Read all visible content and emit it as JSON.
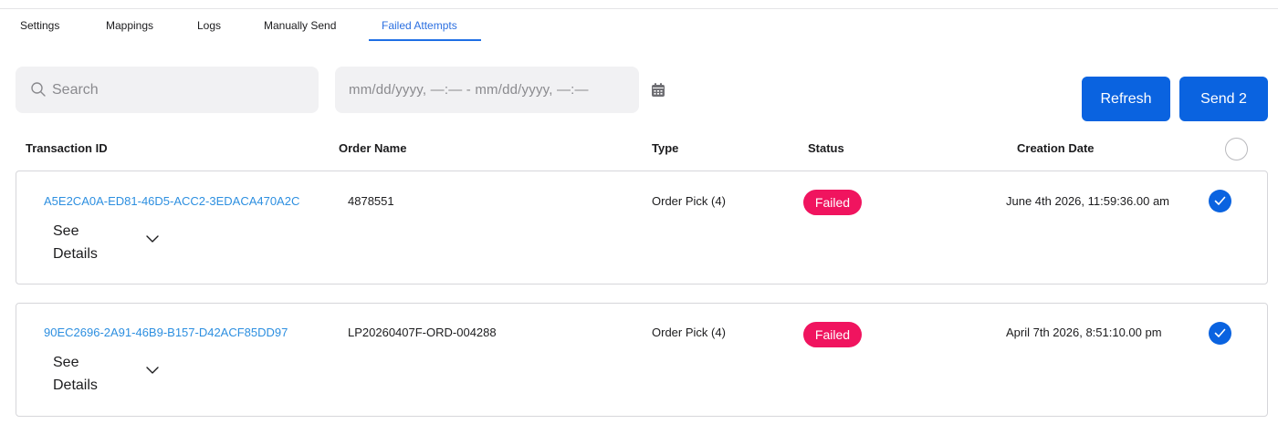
{
  "tabs": [
    {
      "label": "Settings"
    },
    {
      "label": "Mappings"
    },
    {
      "label": "Logs"
    },
    {
      "label": "Manually Send"
    },
    {
      "label": "Failed Attempts",
      "active": true
    }
  ],
  "search": {
    "placeholder": "Search",
    "value": ""
  },
  "date_range": {
    "text": "mm/dd/yyyy, —:—  - mm/dd/yyyy, —:—"
  },
  "buttons": {
    "refresh": "Refresh",
    "send": "Send 2"
  },
  "table": {
    "columns": [
      "Transaction ID",
      "Order Name",
      "Type",
      "Status",
      "Creation Date"
    ],
    "rows": [
      {
        "transaction_id": "A5E2CA0A-ED81-46D5-ACC2-3EDACA470A2C",
        "see_details": "See Details",
        "order_name": "4878551",
        "type": "Order Pick (4)",
        "status": "Failed",
        "creation_date": "June 4th 2026, 11:59:36.00 am",
        "selected": true
      },
      {
        "transaction_id": "90EC2696-2A91-46B9-B157-D42ACF85DD97",
        "see_details": "See Details",
        "order_name": "LP20260407F-ORD-004288",
        "type": "Order Pick (4)",
        "status": "Failed",
        "creation_date": "April 7th 2026, 8:51:10.00 pm",
        "selected": true
      }
    ]
  },
  "colors": {
    "accent": "#0a63e0",
    "link": "#2d8fe0",
    "failed_badge": "#f0145f",
    "input_bg": "#f1f1f3"
  },
  "icons": {
    "search": "search-icon",
    "calendar": "calendar-icon",
    "chevron": "chevron-down-icon",
    "check": "check-icon"
  }
}
